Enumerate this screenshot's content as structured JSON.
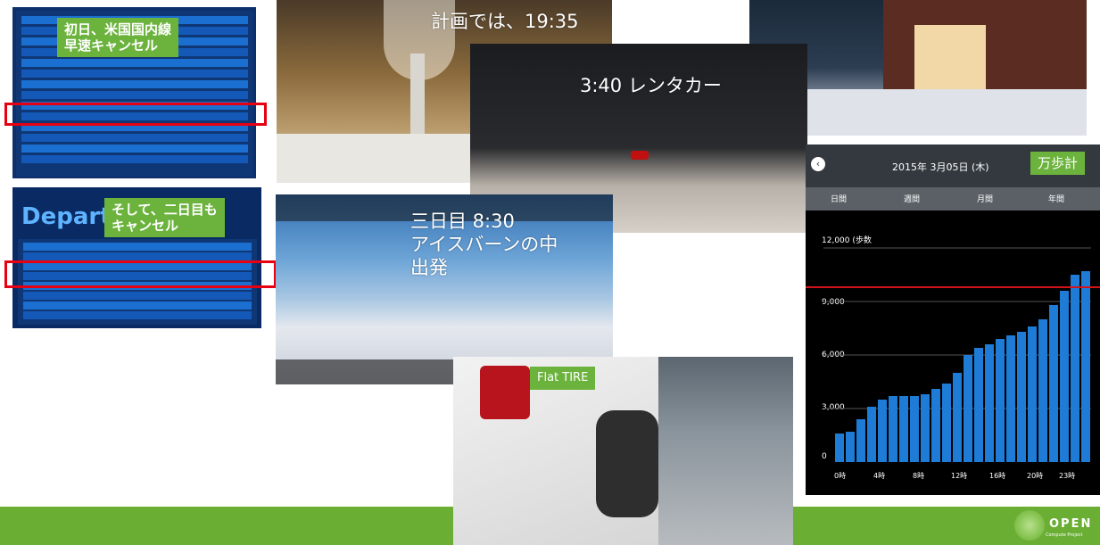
{
  "labels": {
    "day1_cancel": "初日、米国国内線\n早速キャンセル",
    "day2_cancel": "そして、二日目も\nキャンセル",
    "plan": "計画では、19:35",
    "rental": "3:40 レンタカー",
    "day3": "三日目 8:30\nアイスバーンの中\n出発",
    "flat": "Flat TIRE",
    "steps": "万歩計"
  },
  "board": {
    "title": "Departures"
  },
  "pedometer": {
    "date": "2015年 3月05日 (木)",
    "tabs": [
      "日間",
      "週間",
      "月間",
      "年間"
    ],
    "y_header": "12,000 (歩数",
    "y_ticks": [
      "12,000",
      "9,000",
      "6,000",
      "3,000",
      "0"
    ],
    "x_ticks": [
      "0時",
      "4時",
      "8時",
      "12時",
      "16時",
      "20時",
      "23時"
    ]
  },
  "chart_data": {
    "type": "bar",
    "ylim": [
      0,
      12000
    ],
    "values": [
      1600,
      1700,
      2400,
      3100,
      3500,
      3700,
      3700,
      3700,
      3800,
      4100,
      4400,
      5000,
      6000,
      6400,
      6600,
      6900,
      7100,
      7300,
      7600,
      8000,
      8800,
      9600,
      10500,
      10700
    ],
    "reference_line": 9800,
    "colors": {
      "bar": "#1e7bd6",
      "reference": "#d3131a"
    }
  },
  "footer": {
    "brand": "OPEN",
    "sub": "Compute Project"
  },
  "colors": {
    "accent": "#6cb33e",
    "bar": "#6aae34",
    "highlight": "#e60012"
  }
}
